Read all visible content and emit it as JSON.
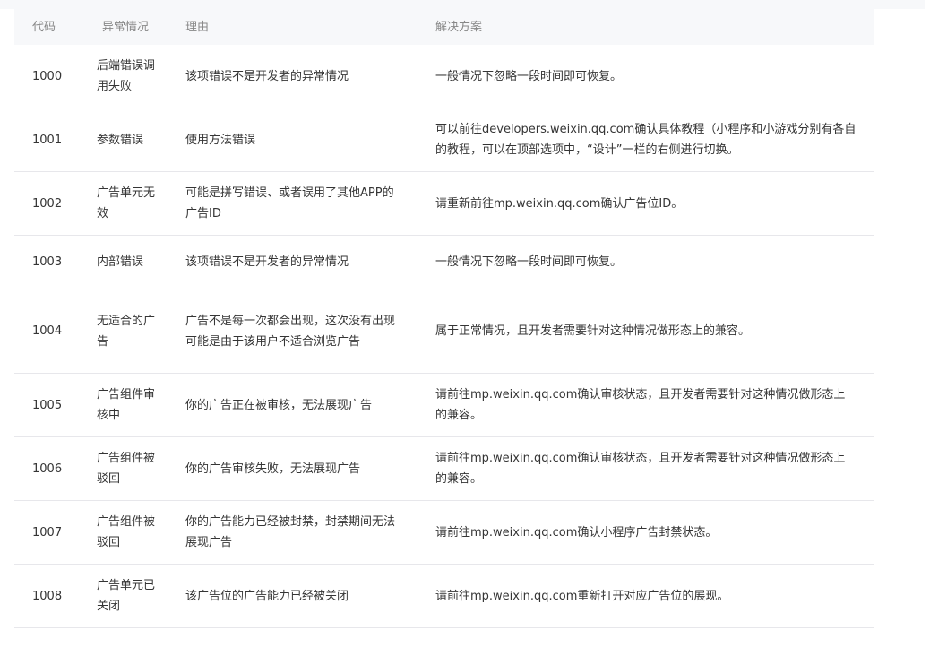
{
  "table": {
    "headers": {
      "code": "代码",
      "type": "异常情况",
      "reason": "理由",
      "solution": "解决方案"
    },
    "rows": [
      {
        "code": "1000",
        "type": "后端错误调用失败",
        "reason": "该项错误不是开发者的异常情况",
        "solution": "一般情况下忽略一段时间即可恢复。"
      },
      {
        "code": "1001",
        "type": "参数错误",
        "reason": "使用方法错误",
        "solution": "可以前往developers.weixin.qq.com确认具体教程（小程序和小游戏分别有各自的教程，可以在顶部选项中，“设计”一栏的右侧进行切换。"
      },
      {
        "code": "1002",
        "type": "广告单元无效",
        "reason": "可能是拼写错误、或者误用了其他APP的广告ID",
        "solution": "请重新前往mp.weixin.qq.com确认广告位ID。"
      },
      {
        "code": "1003",
        "type": "内部错误",
        "reason": "该项错误不是开发者的异常情况",
        "solution": "一般情况下忽略一段时间即可恢复。"
      },
      {
        "code": "1004",
        "type": "无适合的广告",
        "reason": "广告不是每一次都会出现，这次没有出现可能是由于该用户不适合浏览广告",
        "solution": "属于正常情况，且开发者需要针对这种情况做形态上的兼容。"
      },
      {
        "code": "1005",
        "type": "广告组件审核中",
        "reason": "你的广告正在被审核，无法展现广告",
        "solution": "请前往mp.weixin.qq.com确认审核状态，且开发者需要针对这种情况做形态上的兼容。"
      },
      {
        "code": "1006",
        "type": "广告组件被驳回",
        "reason": "你的广告审核失败，无法展现广告",
        "solution": "请前往mp.weixin.qq.com确认审核状态，且开发者需要针对这种情况做形态上的兼容。"
      },
      {
        "code": "1007",
        "type": "广告组件被驳回",
        "reason": "你的广告能力已经被封禁，封禁期间无法展现广告",
        "solution": "请前往mp.weixin.qq.com确认小程序广告封禁状态。"
      },
      {
        "code": "1008",
        "type": "广告单元已关闭",
        "reason": "该广告位的广告能力已经被关闭",
        "solution": "请前往mp.weixin.qq.com重新打开对应广告位的展现。"
      }
    ]
  }
}
